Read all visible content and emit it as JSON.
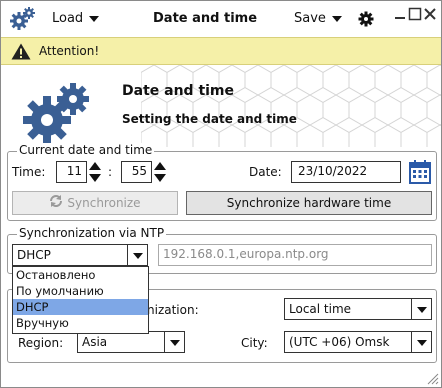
{
  "titlebar": {
    "load_label": "Load",
    "title": "Date and time",
    "save_label": "Save",
    "window_controls": [
      "minimize",
      "maximize",
      "close"
    ]
  },
  "attention": {
    "text": "Attention!"
  },
  "header": {
    "title": "Date and time",
    "subtitle": "Setting the date and time"
  },
  "current": {
    "legend": "Current date and time",
    "time_label": "Time:",
    "hours": "11",
    "separator": ":",
    "minutes": "55",
    "date_label": "Date:",
    "date": "23/10/2022",
    "sync_button": "Synchronize",
    "sync_hw_button": "Synchronize hardware time"
  },
  "ntp": {
    "legend": "Synchronization via NTP",
    "mode": "DHCP",
    "servers": "192.168.0.1,europa.ntp.org",
    "options": [
      "Остановлено",
      "По умолчанию",
      "DHCP",
      "Вручную"
    ],
    "selected_index": 2
  },
  "timezone": {
    "sync_label": "nization:",
    "sync_value": "Local time",
    "region_label": "Region:",
    "region_value": "Asia",
    "city_label": "City:",
    "city_value": "(UTC +06) Omsk"
  },
  "colors": {
    "gear": "#3a5f94",
    "attention_bg": "#f5f0a8",
    "selected_option": "#7ea7e6",
    "calendar": "#2b5aa8"
  }
}
